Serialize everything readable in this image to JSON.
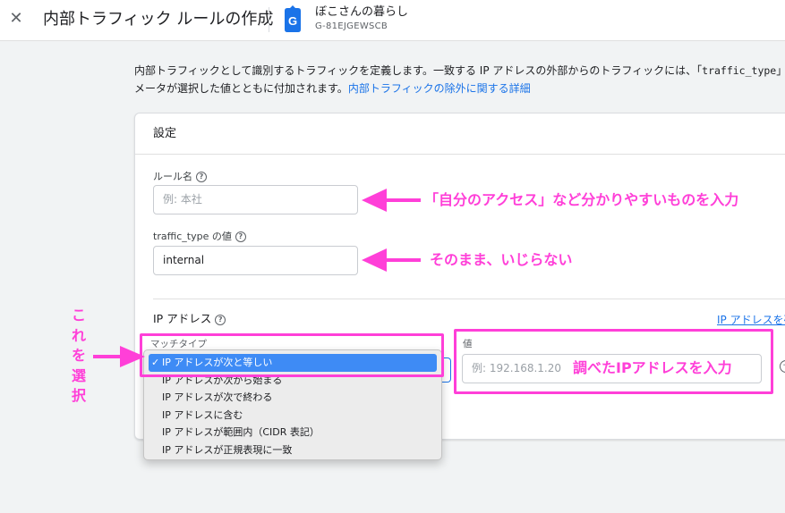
{
  "header": {
    "close_icon": "close-icon",
    "title": "内部トラフィック ルールの作成",
    "property_badge_icon": "google-analytics-tag-icon",
    "property_badge_letter": "G",
    "property_name": "ぼこさんの暮らし",
    "property_id": "G-81EJGEWSCB"
  },
  "intro": {
    "line1_text": "内部トラフィックとして識別するトラフィックを定義します。一致する IP アドレスの外部からのトラフィックには、「",
    "line1_code": "traffic_type",
    "line1_tail": "」",
    "line2_text": "メータが選択した値とともに付加されます。",
    "line2_link": "内部トラフィックの除外に関する詳細"
  },
  "card": {
    "title": "設定",
    "rule_name": {
      "label": "ルール名",
      "placeholder": "例: 本社",
      "value": ""
    },
    "traffic_type": {
      "label": "traffic_type の値",
      "value": "internal"
    },
    "ip_section": {
      "heading": "IP アドレス",
      "right_link": "IP アドレスを確",
      "match_type_label": "マッチタイプ",
      "match_options": [
        {
          "label": "IP アドレスが次と等しい",
          "selected": true
        },
        {
          "label": "IP アドレスが次から始まる",
          "selected": false
        },
        {
          "label": "IP アドレスが次で終わる",
          "selected": false
        },
        {
          "label": "IP アドレスに含む",
          "selected": false
        },
        {
          "label": "IP アドレスが範囲内（CIDR 表記）",
          "selected": false
        },
        {
          "label": "IP アドレスが正規表現に一致",
          "selected": false
        }
      ],
      "check_mark": "✓",
      "value_label": "値",
      "value_placeholder": "例: 192.168.1.20"
    }
  },
  "annotations": {
    "rule_name_note": "「自分のアクセス」など分かりやすいものを入力",
    "traffic_type_note": "そのまま、いじらない",
    "select_note": "これを選択",
    "ip_value_note": "調べたIPアドレスを入力",
    "accent_color": "#ff3fd8"
  },
  "colors": {
    "link": "#1a73e8",
    "selected_option": "#3e8bf5",
    "background": "#f1f3f4"
  }
}
